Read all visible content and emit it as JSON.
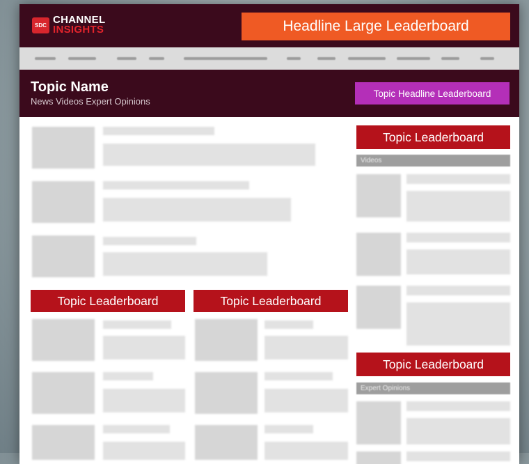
{
  "brand": {
    "badge": "SDC",
    "name_line1": "CHANNEL",
    "name_line2": "INSIGHTS",
    "badge_color": "#d8262d",
    "header_bg": "#3b0a1c"
  },
  "header": {
    "large_leaderboard": "Headline Large Leaderboard",
    "large_leaderboard_color": "#ef5a24"
  },
  "topic": {
    "title": "Topic Name",
    "subnav": "News  Videos  Expert Opinions",
    "headline_leaderboard": "Topic Headline Leaderboard",
    "headline_leaderboard_color": "#b42fb8"
  },
  "leaderboards": {
    "label": "Topic Leaderboard",
    "color": "#b5121b"
  },
  "sidebar": {
    "videos_label": "Videos",
    "expert_label": "Expert Opinions"
  }
}
